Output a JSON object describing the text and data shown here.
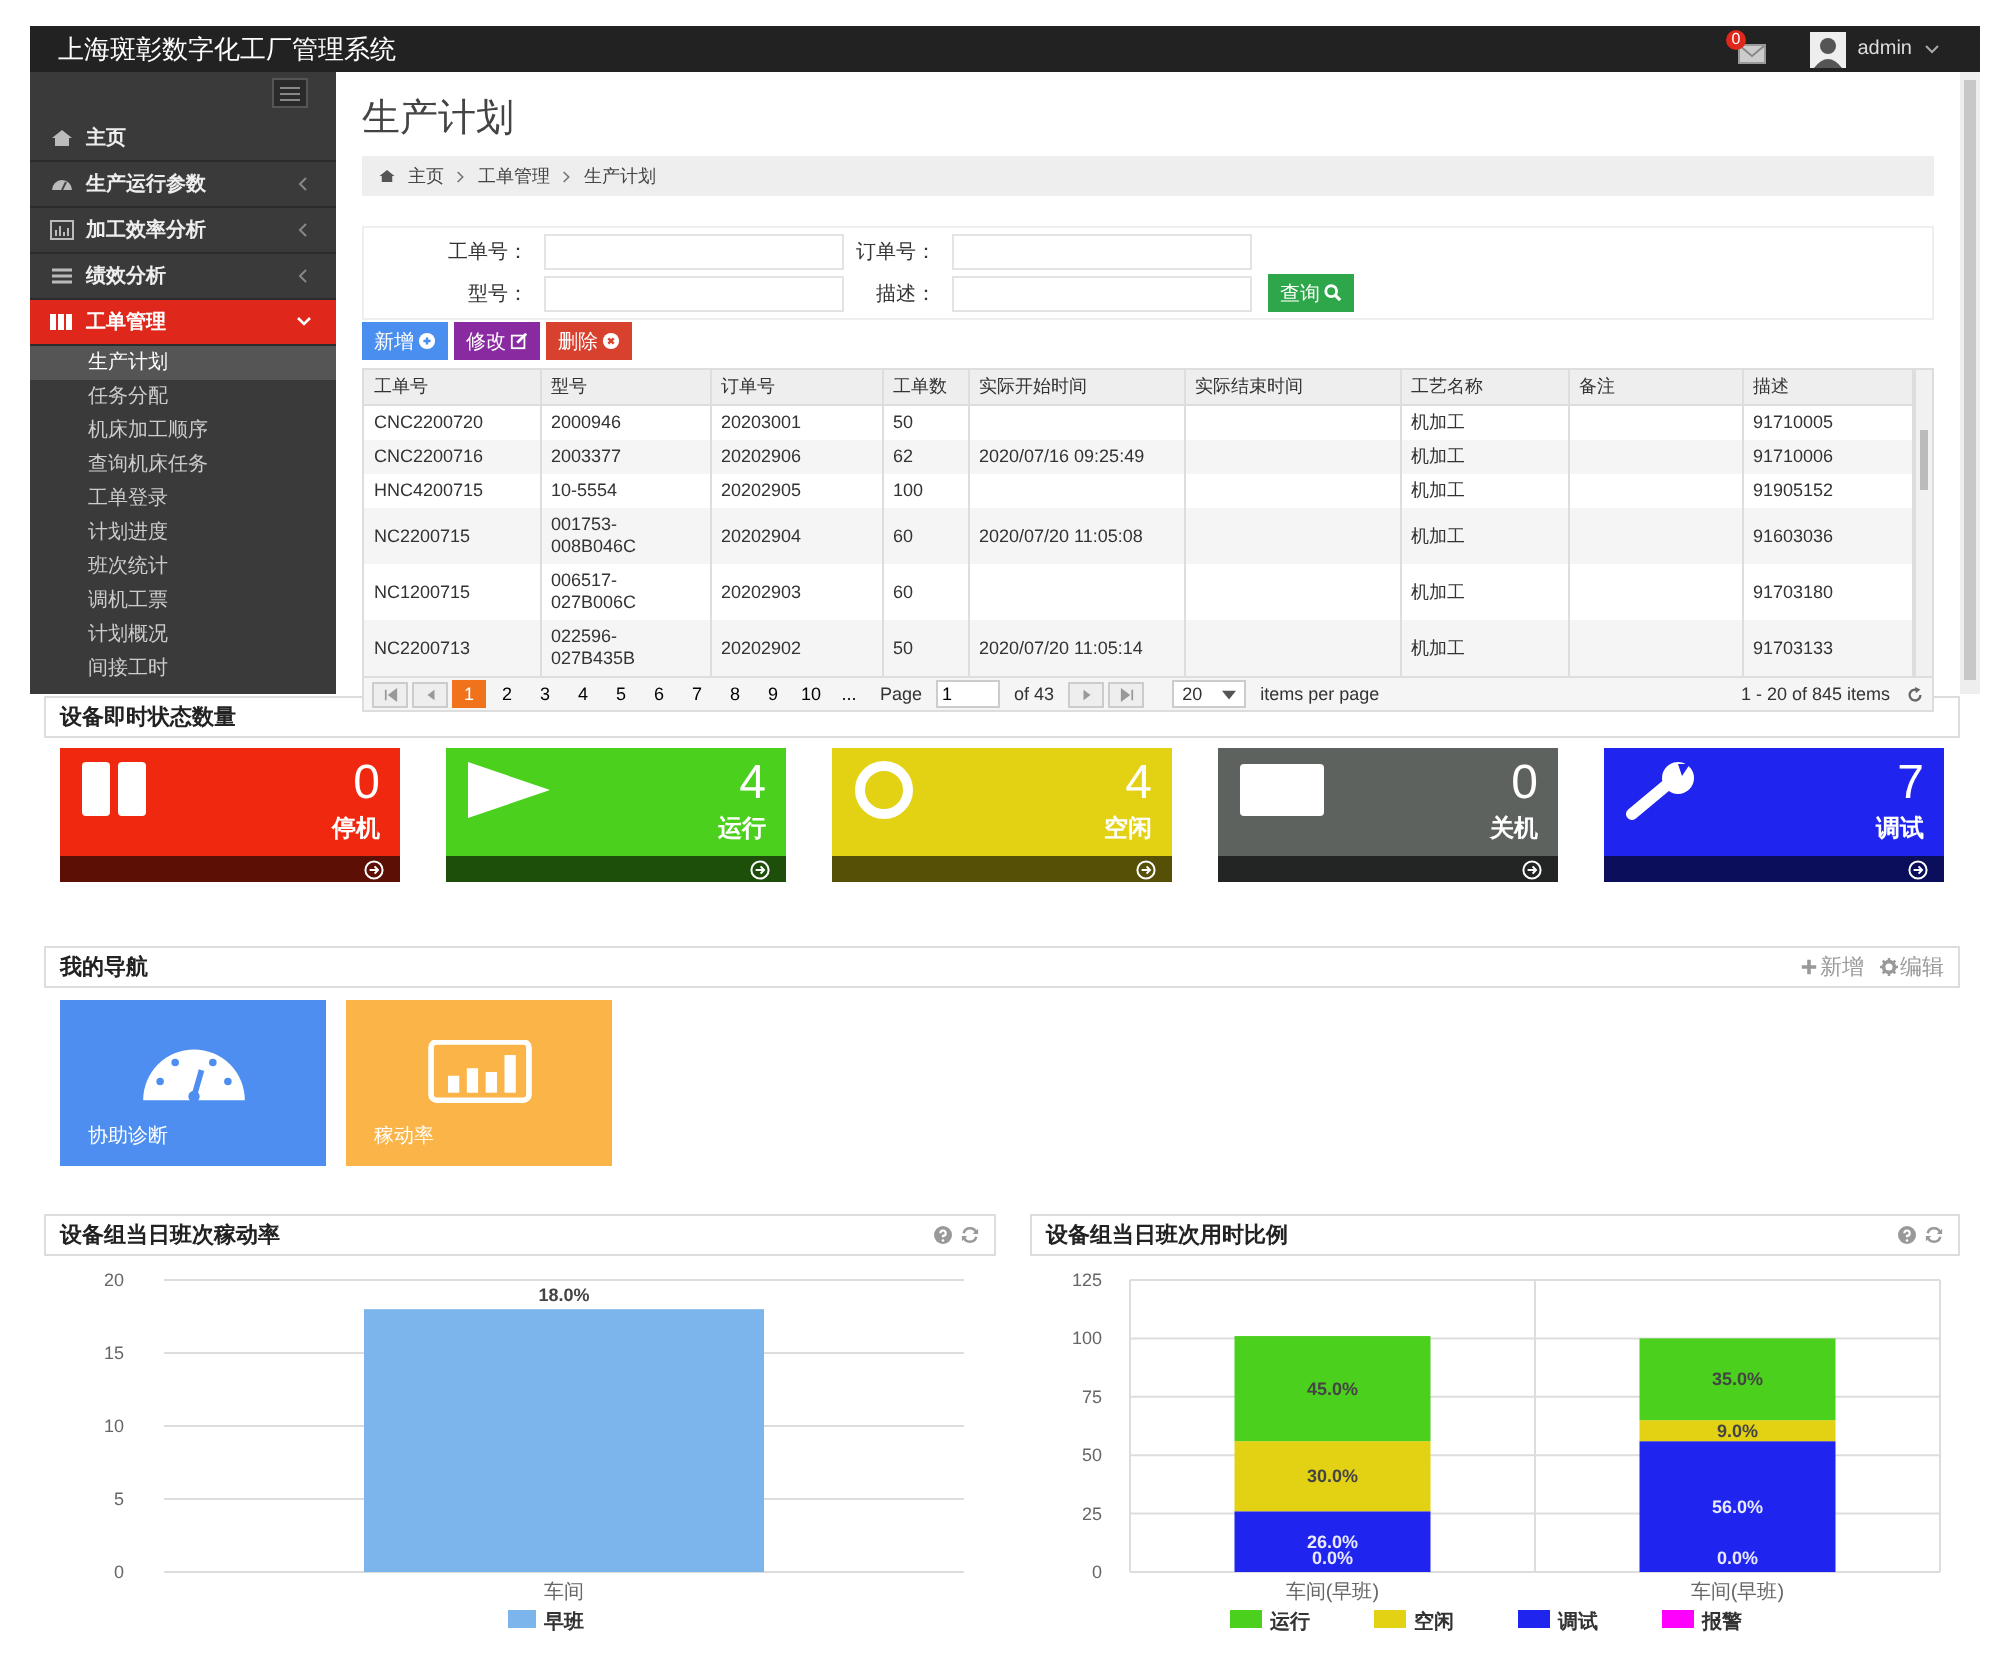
{
  "app": {
    "title": "上海斑彰数字化工厂管理系统",
    "notification_count": "0",
    "user": "admin"
  },
  "sidebar": {
    "items": [
      {
        "label": "主页",
        "kind": "link",
        "selected": false
      },
      {
        "label": "生产运行参数",
        "kind": "group",
        "selected": false,
        "expanded": false
      },
      {
        "label": "加工效率分析",
        "kind": "group",
        "selected": false,
        "expanded": false
      },
      {
        "label": "绩效分析",
        "kind": "group",
        "selected": false,
        "expanded": false
      },
      {
        "label": "工单管理",
        "kind": "group",
        "selected": true,
        "expanded": true,
        "children": [
          {
            "label": "生产计划",
            "selected": true
          },
          {
            "label": "任务分配",
            "selected": false
          },
          {
            "label": "机床加工顺序",
            "selected": false
          },
          {
            "label": "查询机床任务",
            "selected": false
          },
          {
            "label": "工单登录",
            "selected": false
          },
          {
            "label": "计划进度",
            "selected": false
          },
          {
            "label": "班次统计",
            "selected": false
          },
          {
            "label": "调机工票",
            "selected": false
          },
          {
            "label": "计划概况",
            "selected": false
          },
          {
            "label": "间接工时",
            "selected": false
          }
        ]
      }
    ]
  },
  "page_title": "生产计划",
  "breadcrumb": [
    "主页",
    "工单管理",
    "生产计划"
  ],
  "search": {
    "fields": [
      {
        "label": "工单号："
      },
      {
        "label": "订单号："
      },
      {
        "label": "型号："
      },
      {
        "label": "描述："
      }
    ],
    "button": "查询"
  },
  "actions": [
    {
      "label": "新增",
      "kind": "add"
    },
    {
      "label": "修改",
      "kind": "edit"
    },
    {
      "label": "删除",
      "kind": "delete"
    }
  ],
  "table": {
    "columns": [
      "工单号",
      "型号",
      "订单号",
      "工单数",
      "实际开始时间",
      "实际结束时间",
      "工艺名称",
      "备注",
      "描述"
    ],
    "rows": [
      {
        "work_order": "CNC2200720",
        "model": "2000946",
        "order_no": "20203001",
        "quantity": "50",
        "process": "机加工",
        "description": "91710005"
      },
      {
        "work_order": "CNC2200716",
        "model": "2003377",
        "order_no": "20202906",
        "quantity": "62",
        "start_time": "2020/07/16 09:25:49",
        "process": "机加工",
        "description": "91710006"
      },
      {
        "work_order": "HNC4200715",
        "model": "10-5554",
        "order_no": "20202905",
        "quantity": "100",
        "process": "机加工",
        "description": "91905152"
      },
      {
        "work_order": "NC2200715",
        "model": "001753-008B046C",
        "order_no": "20202904",
        "quantity": "60",
        "start_time": "2020/07/20 11:05:08",
        "process": "机加工",
        "description": "91603036"
      },
      {
        "work_order": "NC1200715",
        "model": "006517-027B006C",
        "order_no": "20202903",
        "quantity": "60",
        "process": "机加工",
        "description": "91703180"
      },
      {
        "work_order": "NC2200713",
        "model": "022596-027B435B",
        "order_no": "20202902",
        "quantity": "50",
        "start_time": "2020/07/20 11:05:14",
        "process": "机加工",
        "description": "91703133"
      }
    ]
  },
  "pager": {
    "pages": [
      {
        "label": "1",
        "selected": true
      },
      {
        "label": "2",
        "selected": false
      },
      {
        "label": "3",
        "selected": false
      },
      {
        "label": "4",
        "selected": false
      },
      {
        "label": "5",
        "selected": false
      },
      {
        "label": "6",
        "selected": false
      },
      {
        "label": "7",
        "selected": false
      },
      {
        "label": "8",
        "selected": false
      },
      {
        "label": "9",
        "selected": false
      },
      {
        "label": "10",
        "selected": false
      }
    ],
    "more": "...",
    "page_label": "Page",
    "page_value": "1",
    "of_pages": "of 43",
    "page_size": "20",
    "page_size_label": "items per page",
    "summary": "1 - 20 of 845 items"
  },
  "status": {
    "title": "设备即时状态数量",
    "cards": [
      {
        "count": "0",
        "label": "停机",
        "kind": "stop",
        "color": "#f0280f"
      },
      {
        "count": "4",
        "label": "运行",
        "kind": "run",
        "color": "#4cd01e"
      },
      {
        "count": "4",
        "label": "空闲",
        "kind": "idle",
        "color": "#e3d213"
      },
      {
        "count": "0",
        "label": "关机",
        "kind": "off",
        "color": "#5e625f"
      },
      {
        "count": "7",
        "label": "调试",
        "kind": "debug",
        "color": "#1f25ef"
      }
    ]
  },
  "navigation": {
    "title": "我的导航",
    "actions": [
      {
        "label": "新增",
        "kind": "add"
      },
      {
        "label": "编辑",
        "kind": "edit"
      }
    ],
    "tiles": [
      {
        "label": "协助诊断",
        "kind": "gauge",
        "color": "#4d8ef0"
      },
      {
        "label": "稼动率",
        "kind": "chart",
        "color": "#fbb447"
      }
    ]
  },
  "charts": [
    {
      "chart_data": {
        "type": "bar",
        "title": "设备组当日班次稼动率",
        "categories": [
          "车间"
        ],
        "series": [
          {
            "name": "早班",
            "color": "#7cb5ec",
            "values": [
              18
            ]
          }
        ],
        "ylim": [
          0,
          20
        ],
        "yticks": [
          0,
          5,
          10,
          15,
          20
        ],
        "grid": true,
        "legend": "bottom",
        "value_labels": [
          [
            "18.0%"
          ]
        ]
      }
    },
    {
      "chart_data": {
        "type": "bar",
        "title": "设备组当日班次用时比例",
        "stacked": true,
        "categories": [
          "车间(早班)",
          "车间(早班)"
        ],
        "series": [
          {
            "name": "运行",
            "color": "#4cd01e",
            "values": [
              45,
              35
            ]
          },
          {
            "name": "空闲",
            "color": "#e3d213",
            "values": [
              30,
              9
            ]
          },
          {
            "name": "调试",
            "color": "#1f25ef",
            "values": [
              26,
              56
            ]
          },
          {
            "name": "报警",
            "color": "#ff00ff",
            "values": [
              0,
              0
            ]
          }
        ],
        "ylim": [
          0,
          125
        ],
        "yticks": [
          0,
          25,
          50,
          75,
          100,
          125
        ],
        "grid": true,
        "legend": "bottom",
        "value_labels": [
          [
            "45.0%",
            "35.0%"
          ],
          [
            "30.0%",
            "9.0%"
          ],
          [
            "26.0%",
            "56.0%"
          ],
          [
            "0.0%",
            "0.0%"
          ]
        ]
      }
    }
  ]
}
